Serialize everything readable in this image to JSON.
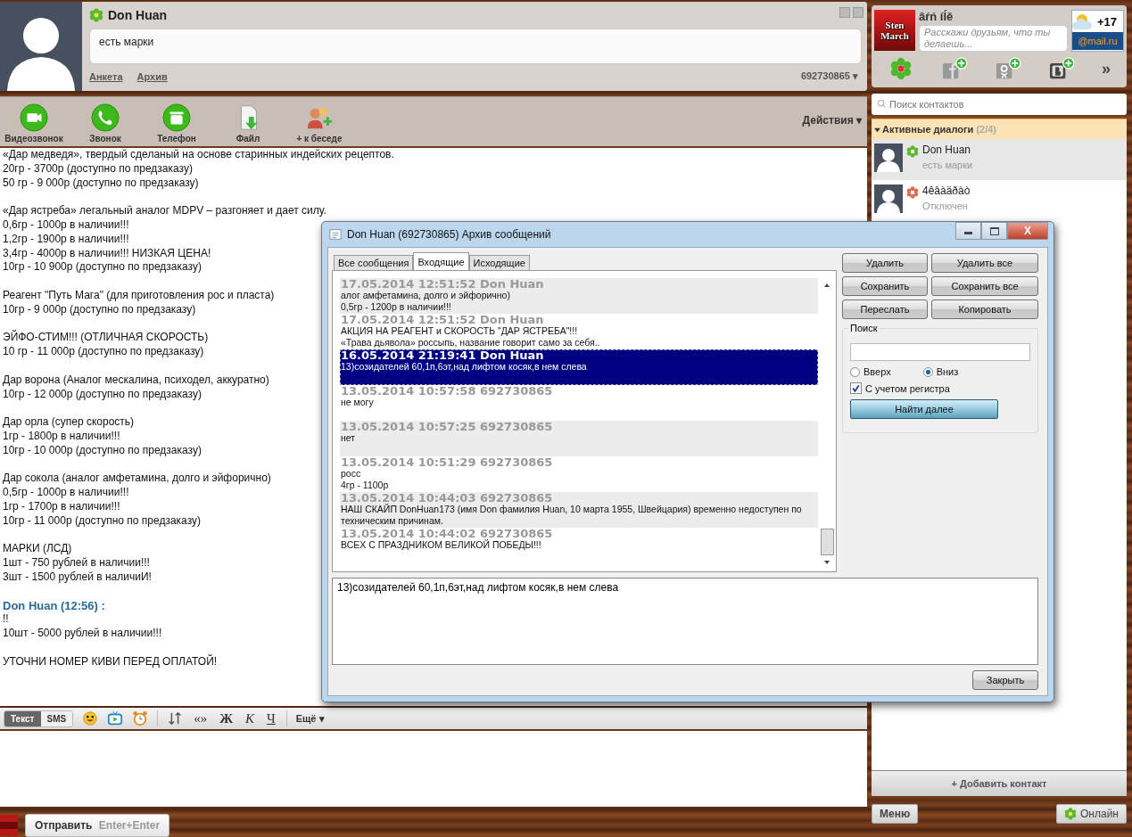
{
  "contact_header": {
    "name": "Don Huan",
    "status_message": "есть марки",
    "links": [
      "Анкета",
      "Архив"
    ],
    "number": "692730865",
    "number_caret": "▾"
  },
  "toolbar": {
    "buttons": [
      {
        "kind": "video",
        "label": "Видеозвонок"
      },
      {
        "kind": "call",
        "label": "Звонок"
      },
      {
        "kind": "phone",
        "label": "Телефон"
      },
      {
        "kind": "file",
        "label": "Файл"
      },
      {
        "kind": "group",
        "label": "+ к беседе"
      }
    ],
    "actions": "Действия",
    "actions_caret": "▾"
  },
  "chat": {
    "blocks": [
      {
        "kind": "text",
        "lines": [
          "«Дар медведя», твердый сделаный на основе старинных индейских рецептов.",
          "20гр - 3700р (доступно по предзаказу)",
          "50 гр - 9 000р (доступно по предзаказу)"
        ]
      },
      {
        "kind": "text",
        "lines": [
          "«Дар ястреба» легальный аналог MDPV – разгоняет и дает силу.",
          "0,6гр - 1000р в наличии!!!",
          "1,2гр - 1900р в наличии!!!",
          "3,4гр - 4000р в наличии!!! НИЗКАЯ ЦЕНА!",
          "10гр - 10 900р (доступно по предзаказу)"
        ]
      },
      {
        "kind": "text",
        "lines": [
          "Реагент \"Путь Мага\" (для приготовления рос и пласта)",
          "10гр - 9 000р (доступно по предзаказу)"
        ]
      },
      {
        "kind": "text",
        "lines": [
          "ЭЙФО-СТИМ!!! (ОТЛИЧНАЯ СКОРОСТЬ)",
          "10 гр - 11 000р (доступно по предзаказу)"
        ]
      },
      {
        "kind": "text",
        "lines": [
          "Дар ворона (Аналог мескалина, психодел, аккуратно)",
          "10гр - 12 000р (доступно по предзаказу)"
        ]
      },
      {
        "kind": "text",
        "lines": [
          "Дар орла (супер скорость)",
          "1гр - 1800р в наличии!!!",
          "10гр - 10 000р (доступно по предзаказу)"
        ]
      },
      {
        "kind": "text",
        "lines": [
          "Дар сокола (аналог амфетамина, долго и эйфорично)",
          "0,5гр - 1000р в наличии!!!",
          "1гр - 1700р в наличии!!!",
          "10гр - 11 000р (доступно по предзаказу)"
        ]
      },
      {
        "kind": "text",
        "lines": [
          "МАРКИ (ЛСД)",
          "1шт - 750 рублей в наличии!!!",
          "3шт - 1500 рублей в наличиИ!"
        ]
      },
      {
        "kind": "sender",
        "text": "Don Huan (12:56) :"
      },
      {
        "kind": "text",
        "lines": [
          "!!",
          "10шт - 5000 рублей в наличии!!!"
        ]
      },
      {
        "kind": "text",
        "lines": [
          "УТОЧНИ НОМЕР КИВИ ПЕРЕД ОПЛАТОЙ!"
        ]
      }
    ]
  },
  "format_bar": {
    "modes": [
      {
        "label": "Текст",
        "selected": true
      },
      {
        "label": "SMS",
        "selected": false
      }
    ],
    "text_buttons": [
      "«»",
      "Ж",
      "К",
      "Ч"
    ],
    "more": "Ещё",
    "more_caret": "▾"
  },
  "send": {
    "label": "Отправить",
    "shortcut": "Enter+Enter"
  },
  "profile": {
    "avatar_text": [
      "Sten",
      "March"
    ],
    "name": "âŕń íĺě",
    "status_placeholder": "Расскажи друзьям, что ты делаешь...",
    "weather": {
      "temperature": "+17",
      "provider": "@mail.ru"
    },
    "more": "»"
  },
  "contact_search": {
    "placeholder": "Поиск контактов"
  },
  "group": {
    "title": "Активные диалоги",
    "count": "(2/4)",
    "expanded": true
  },
  "contacts": [
    {
      "name": "Don Huan",
      "status": "есть марки",
      "color": "#5cb82c",
      "selected": true
    },
    {
      "name": "4êâàäðàò",
      "status": "Отключен",
      "color": "#e06a5a",
      "selected": false
    }
  ],
  "add_contact": "+ Добавить контакт",
  "bottom": {
    "menu": "Меню",
    "status": "Онлайн"
  },
  "archive": {
    "title": "Don Huan (692730865) Архив сообщений",
    "close_glyph": "X",
    "tabs": [
      {
        "label": "Все сообщения",
        "selected": false
      },
      {
        "label": "Входящие",
        "selected": true
      },
      {
        "label": "Исходящие",
        "selected": false
      }
    ],
    "messages": [
      {
        "header": "17.05.2014 12:51:52 Don Huan",
        "lines": [
          "алог амфетамина, долго и эйфорично)",
          "0,5гр - 1200р в наличии!!!"
        ],
        "selected": false
      },
      {
        "header": "17.05.2014 12:51:52 Don Huan",
        "lines": [
          "АКЦИЯ НА РЕАГЕНТ и СКОРОСТЬ \"ДАР ЯСТРЕБА\"!!!",
          "«Трава дьявола» россыпь, название говорит само за себя.."
        ],
        "selected": false
      },
      {
        "header": "16.05.2014 21:19:41 Don Huan",
        "lines": [
          "13)созидателей 60,1п,6эт,над лифтом косяк,в нем слева"
        ],
        "selected": true
      },
      {
        "header": "13.05.2014 10:57:58 692730865",
        "lines": [
          "не могу"
        ],
        "selected": false
      },
      {
        "header": "13.05.2014 10:57:25 692730865",
        "lines": [
          "нет"
        ],
        "selected": false
      },
      {
        "header": "13.05.2014 10:51:29 692730865",
        "lines": [
          "росс",
          "4гр - 1100р"
        ],
        "selected": false
      },
      {
        "header": "13.05.2014 10:44:03 692730865",
        "lines": [
          "НАШ СКАЙП  DonHuan173 (имя Don фамилия Huan, 10 марта 1955, Швейцария) временно недоступен по",
          "техническим причинам."
        ],
        "selected": false
      },
      {
        "header": "13.05.2014 10:44:02 692730865",
        "lines": [
          "ВСЕХ С ПРАЗДНИКОМ ВЕЛИКОЙ ПОБЕДЫ!!!"
        ],
        "selected": false
      }
    ],
    "buttons": [
      "Удалить",
      "Удалить все",
      "Сохранить",
      "Сохранить все",
      "Переслать",
      "Копировать"
    ],
    "search": {
      "title": "Поиск",
      "directions": [
        {
          "label": "Вверх",
          "selected": false
        },
        {
          "label": "Вниз",
          "selected": true
        }
      ],
      "match_case": {
        "label": "С учетом регистра",
        "checked": true
      },
      "find": "Найти далее"
    },
    "preview": "13)созидателей 60,1п,6эт,над лифтом косяк,в нем слева",
    "close": "Закрыть"
  }
}
